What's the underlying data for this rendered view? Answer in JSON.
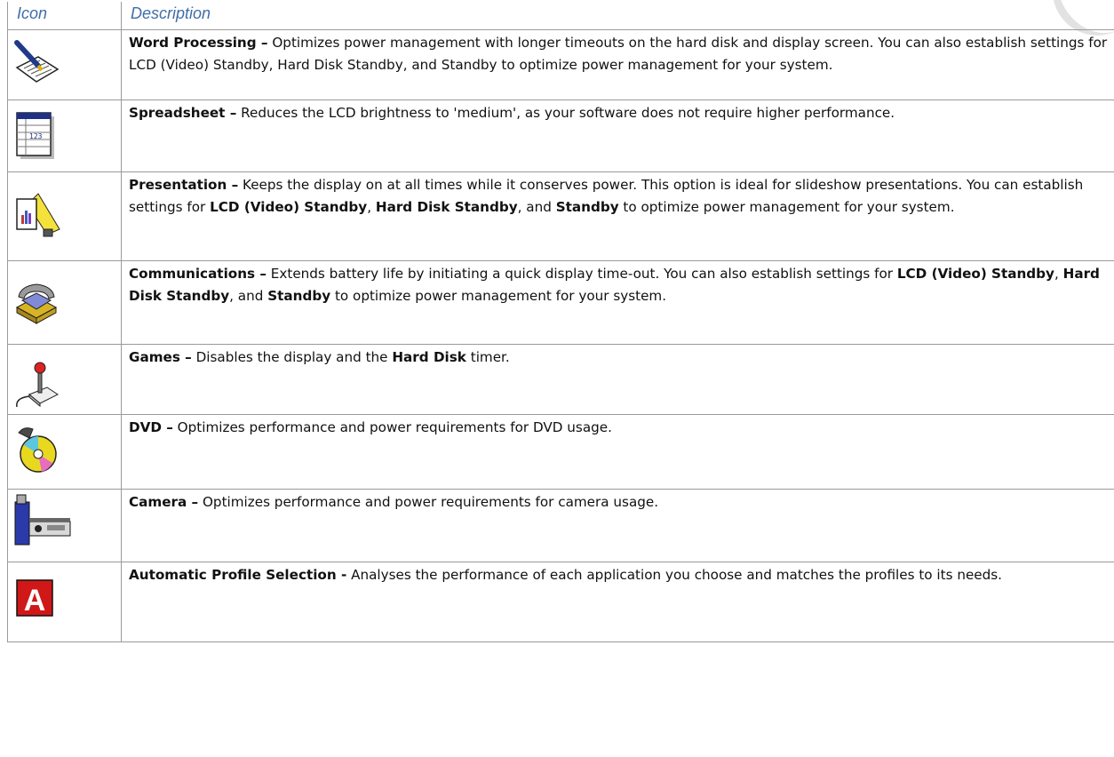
{
  "table": {
    "header": {
      "icon": "Icon",
      "description": "Description"
    },
    "rows": [
      {
        "icon": "word-processing-icon",
        "title": "Word Processing –",
        "d1": " Optimizes power management with longer timeouts on the hard disk and display screen. You can also establish settings for LCD (Video) Standby, Hard Disk Standby, and Standby to optimize power management for your system."
      },
      {
        "icon": "spreadsheet-icon",
        "title": "Spreadsheet –",
        "d1": " Reduces the LCD brightness to 'medium', as your software does not require higher performance."
      },
      {
        "icon": "presentation-icon",
        "title": "Presentation –",
        "d1": " Keeps the display on at all times while it conserves power. This option is ideal for slideshow presentations. You can establish settings for ",
        "b1": "LCD (Video) Standby",
        "d2": ", ",
        "b2": "Hard Disk Standby",
        "d3": ", and ",
        "b3": "Standby",
        "d4": " to optimize power management for your system."
      },
      {
        "icon": "communications-icon",
        "title": "Communications –",
        "d1": " Extends battery life by initiating a quick display time-out. You can also establish settings for ",
        "b1": "LCD (Video) Standby",
        "d2": ", ",
        "b2": "Hard Disk Standby",
        "d3": ", and ",
        "b3": "Standby",
        "d4": " to optimize power management for your system."
      },
      {
        "icon": "games-icon",
        "title": "Games –",
        "d1": " Disables the display and the ",
        "b1": "Hard Disk",
        "d2": " timer."
      },
      {
        "icon": "dvd-icon",
        "title": "DVD –",
        "d1": " Optimizes performance and power requirements for DVD usage."
      },
      {
        "icon": "camera-icon",
        "title": "Camera –",
        "d1": " Optimizes performance and power requirements for camera usage."
      },
      {
        "icon": "automatic-profile-icon",
        "title": "Automatic Profile Selection -",
        "d1": " Analyses the performance of each application you choose and matches the profiles to its needs.",
        "icon_letter": "A"
      }
    ]
  }
}
